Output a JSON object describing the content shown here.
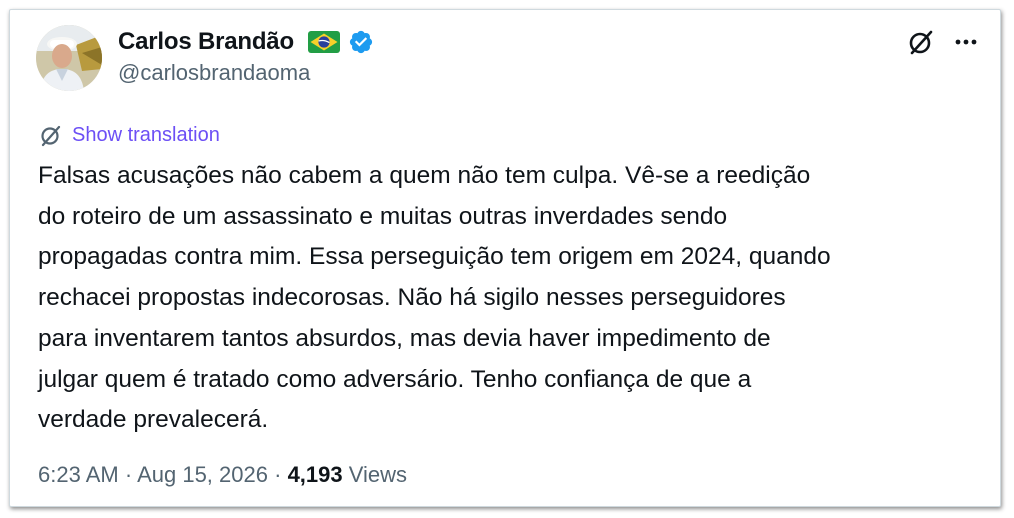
{
  "author": {
    "name": "Carlos Brandão",
    "handle": "@carlosbrandaoma",
    "flag_icon": "brazil-flag-icon",
    "verified_icon": "verified-badge-icon"
  },
  "header_actions": {
    "grok_icon": "grok-icon",
    "more_icon": "more-options-icon"
  },
  "translation": {
    "label": "Show translation",
    "icon": "translate-icon"
  },
  "tweet": {
    "lines": [
      "Falsas acusações não cabem a quem não tem culpa. Vê-se a reedição",
      "do roteiro de um assassinato e muitas outras inverdades sendo",
      "propagadas contra mim. Essa perseguição tem origem em 2024, quando",
      "rechacei propostas indecorosas. Não há sigilo nesses perseguidores",
      "para inventarem tantos absurdos, mas devia haver impedimento de",
      "julgar quem é tratado como adversário. Tenho confiança de que a",
      "verdade prevalecerá."
    ]
  },
  "meta": {
    "time": "6:23 AM",
    "separator": "·",
    "date": "Aug 15, 2026",
    "views_count": "4,193",
    "views_label": "Views"
  },
  "colors": {
    "text_primary": "#0f1419",
    "text_secondary": "#536471",
    "link_purple": "#6c4ff5",
    "verified_blue": "#1d9bf0",
    "border": "#cfd9de"
  }
}
